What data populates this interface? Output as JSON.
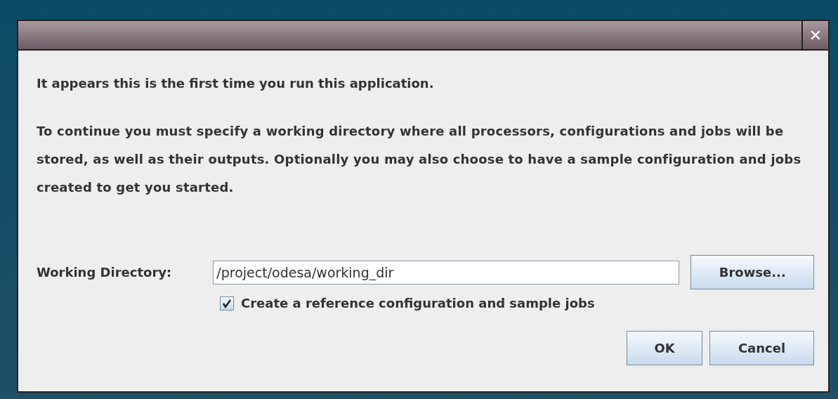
{
  "dialog": {
    "close_symbol": "✕"
  },
  "messages": [
    "It appears this is the first time you run this application.",
    "To continue you must specify a working directory where all processors, configurations and jobs will be stored, as well as their outputs. Optionally you may also choose to have a sample configuration and jobs created to get you started."
  ],
  "working_directory": {
    "label": "Working Directory:",
    "value": "/project/odesa/working_dir",
    "browse_button": "Browse..."
  },
  "sample_option": {
    "label": "Create a reference configuration and sample jobs",
    "checked": true
  },
  "buttons": [
    {
      "label": "OK"
    },
    {
      "label": "Cancel"
    }
  ]
}
